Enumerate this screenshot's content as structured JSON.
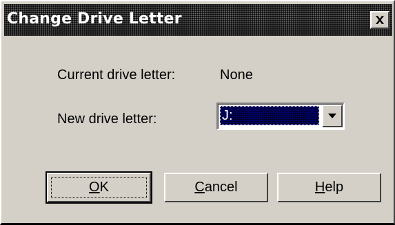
{
  "window": {
    "title": "Change Drive Letter",
    "close_glyph": "✕"
  },
  "form": {
    "current_label": "Current drive letter:",
    "current_value": "None",
    "new_label": "New drive letter:",
    "new_value": "J:"
  },
  "buttons": {
    "ok": {
      "accel": "O",
      "rest": "K"
    },
    "cancel": {
      "accel": "C",
      "rest": "ancel"
    },
    "help": {
      "accel": "H",
      "rest": "elp"
    }
  },
  "icons": {
    "close": "close-icon",
    "dropdown": "chevron-down-icon"
  },
  "colors": {
    "face": "#d4d0c8",
    "title_bar": "#000000",
    "selection": "#000080"
  }
}
